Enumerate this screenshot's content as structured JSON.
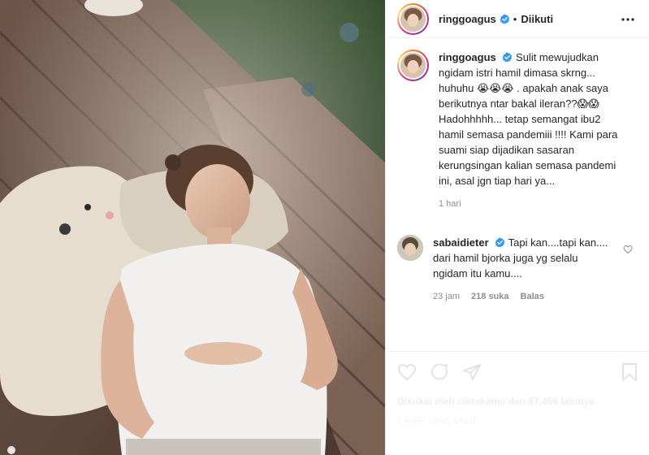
{
  "header": {
    "username": "ringgoagus",
    "separator": "•",
    "follow_status": "Diikuti",
    "more_icon": "more-horizontal-icon"
  },
  "caption": {
    "username": "ringgoagus",
    "lines": [
      "Sulit mewujudkan",
      "ngidam istri hamil dimasa skrng...",
      "huhuhu 😭😭😭 . apakah anak saya",
      "berikutnya ntar bakal ileran??😱😱",
      "Hadohhhhh... tetap semangat ibu2",
      "hamil semasa pandemiii !!!! Kami para",
      "suami siap dijadikan sasaran",
      "kerungsingan kalian semasa pandemi",
      "ini, asal jgn tiap hari ya..."
    ],
    "time": "1 hari"
  },
  "reply": {
    "username": "sabaidieter",
    "lines": [
      "Tapi kan....tapi kan....",
      "dari hamil bjorka juga yg selalu",
      "ngidam itu kamu...."
    ],
    "time": "23 jam",
    "likes": "218 suka",
    "reply_label": "Balas"
  },
  "faded": {
    "likes_line": "Disukai oleh cintakamu dan 87.456 lainnya",
    "date_line": "1 HARI YANG LALU"
  },
  "colors": {
    "verified": "#3897f0",
    "text": "#262626",
    "muted": "#8e8e8e",
    "border": "#efefef"
  }
}
